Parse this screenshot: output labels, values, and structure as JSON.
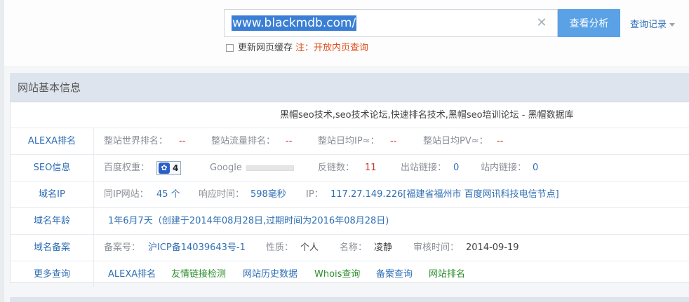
{
  "search": {
    "value": "www.blackmdb.com/",
    "button": "查看分析",
    "history": "查询记录"
  },
  "cache": {
    "label": "更新网页缓存",
    "note": "注：开放内页查询"
  },
  "panel": {
    "header": "网站基本信息",
    "site_title": "黑帽seo技术,seo技术论坛,快速排名技术,黑帽seo培训论坛 - 黑帽数据库",
    "alexa": {
      "label": "ALEXA排名",
      "world_label": "整站世界排名：",
      "world_value": "--",
      "traffic_label": "整站流量排名：",
      "traffic_value": "--",
      "ip_label": "整站日均IP≈：",
      "ip_value": "--",
      "pv_label": "整站日均PV≈：",
      "pv_value": "--"
    },
    "seo": {
      "label": "SEO信息",
      "baidu_label": "百度权重：",
      "baidu_value": "4",
      "google_label": "Google",
      "backlinks_label": "反链数：",
      "backlinks_value": "11",
      "outlinks_label": "出站链接：",
      "outlinks_value": "0",
      "inlinks_label": "站内链接：",
      "inlinks_value": "0"
    },
    "domain_ip": {
      "label": "域名IP",
      "same_ip_label": "同IP网站：",
      "same_ip_value": "45 个",
      "response_label": "响应时间：",
      "response_value": "598毫秒",
      "ip_label": "IP：",
      "ip_value": "117.27.149.226[福建省福州市 百度网讯科技电信节点]"
    },
    "domain_age": {
      "label": "域名年龄",
      "value": "1年6月7天（创建于2014年08月28日,过期时间为2016年08月28日)"
    },
    "icp": {
      "label": "域名备案",
      "no_label": "备案号：",
      "no_value": "沪ICP备14039643号-1",
      "type_label": "性质：",
      "type_value": "个人",
      "name_label": "名称：",
      "name_value": "凌静",
      "date_label": "审核时间：",
      "date_value": "2014-09-19"
    },
    "more": {
      "label": "更多查询",
      "links": [
        "ALEXA排名",
        "友情链接检测",
        "网站历史数据",
        "Whois查询",
        "备案查询",
        "网站排名"
      ]
    }
  },
  "colors": {
    "accent": "#5aa1e6",
    "link": "#2f6fb5",
    "warn": "#e0521d",
    "red_value": "#c9352b",
    "green_link": "#2f8f2f"
  }
}
